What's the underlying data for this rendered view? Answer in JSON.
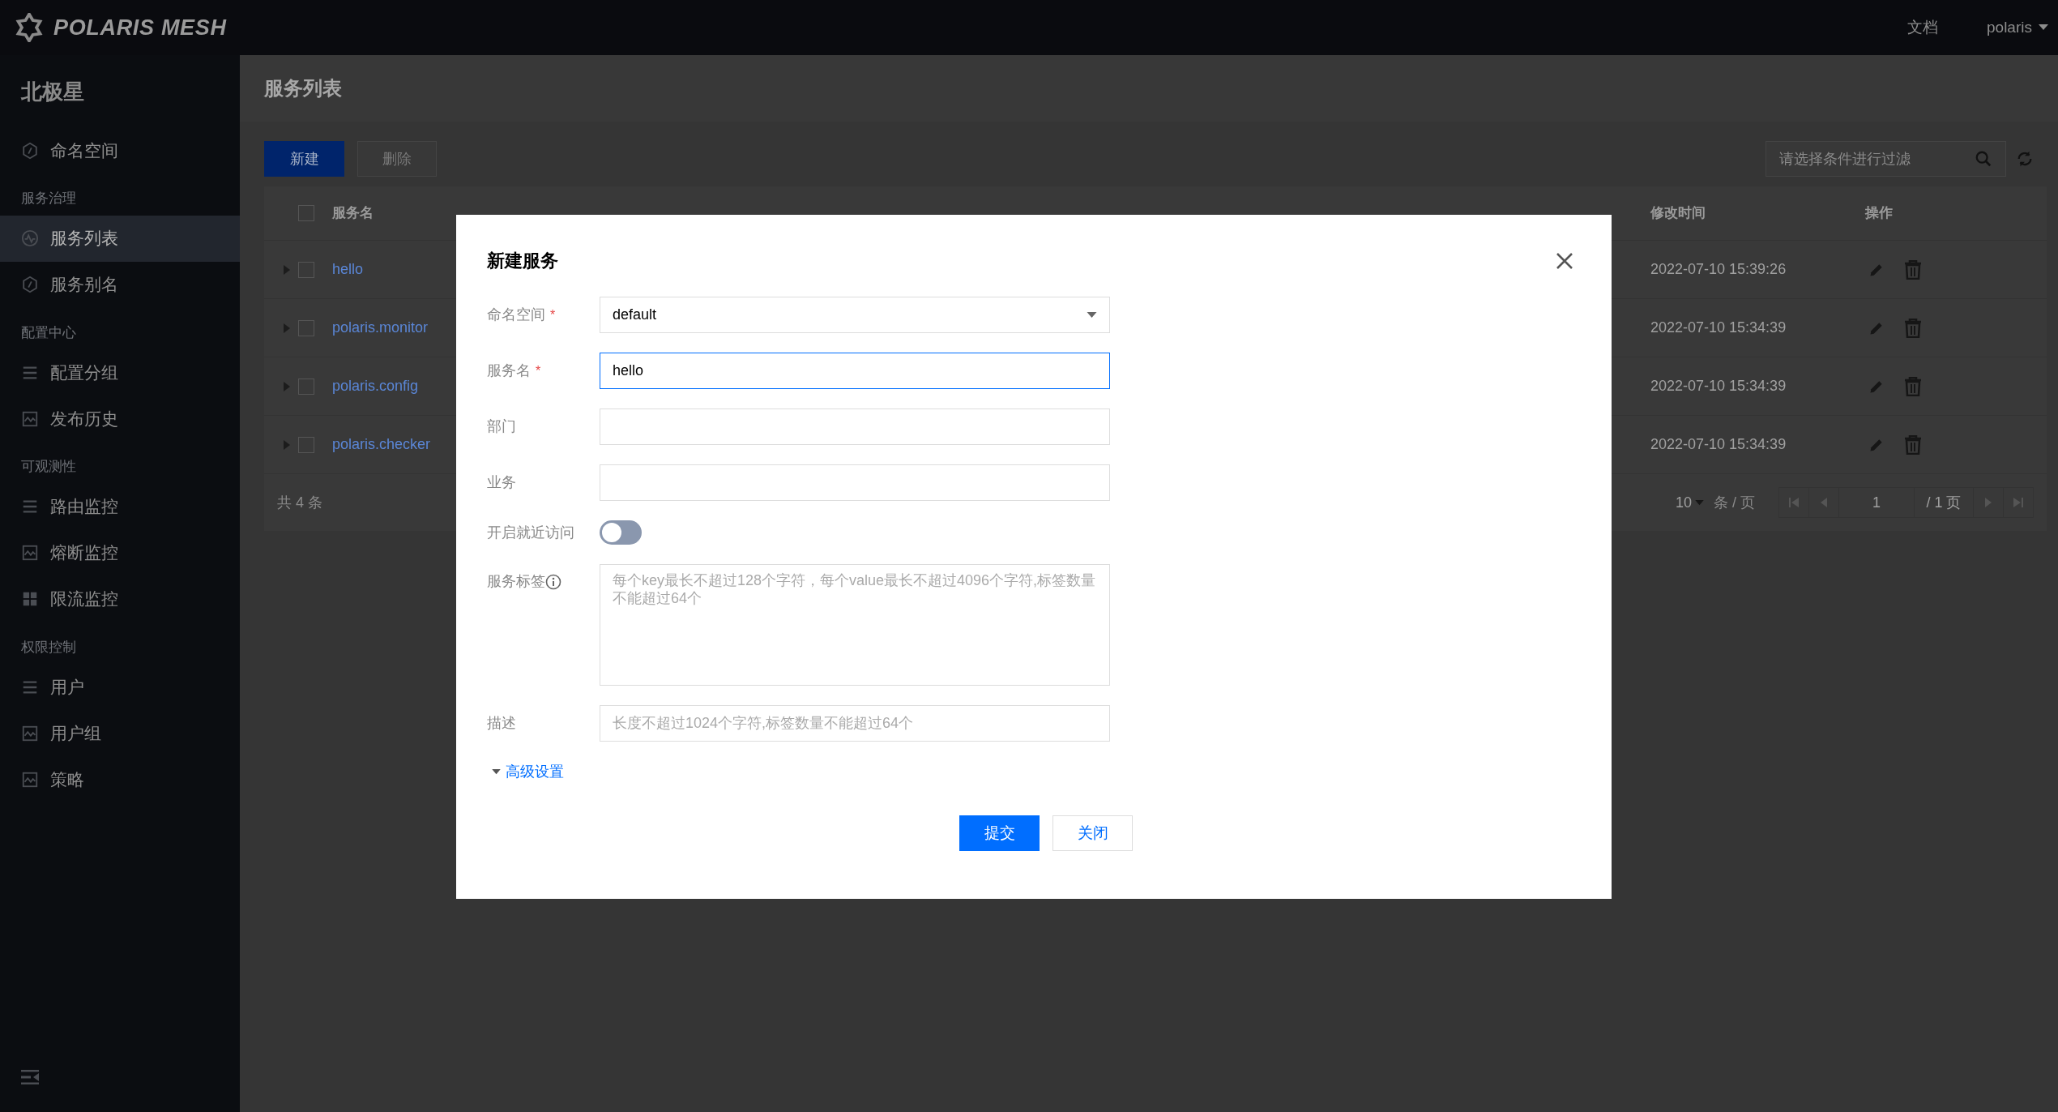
{
  "brand": "POLARIS MESH",
  "topbar": {
    "links": [
      "文档"
    ],
    "user": "polaris"
  },
  "sidebar": {
    "title": "北极星",
    "sections": [
      {
        "items": [
          {
            "label": "命名空间",
            "kind": "hexagon",
            "selected": false
          }
        ]
      },
      {
        "heading": "服务治理",
        "items": [
          {
            "label": "服务列表",
            "kind": "pulse",
            "selected": true
          },
          {
            "label": "服务别名",
            "kind": "hexagon",
            "selected": false
          }
        ]
      },
      {
        "heading": "配置中心",
        "items": [
          {
            "label": "配置分组",
            "kind": "list",
            "selected": false
          },
          {
            "label": "发布历史",
            "kind": "chart",
            "selected": false
          }
        ]
      },
      {
        "heading": "可观测性",
        "items": [
          {
            "label": "路由监控",
            "kind": "list",
            "selected": false
          },
          {
            "label": "熔断监控",
            "kind": "chart",
            "selected": false
          },
          {
            "label": "限流监控",
            "kind": "grid",
            "selected": false
          }
        ]
      },
      {
        "heading": "权限控制",
        "items": [
          {
            "label": "用户",
            "kind": "list",
            "selected": false
          },
          {
            "label": "用户组",
            "kind": "chart",
            "selected": false
          },
          {
            "label": "策略",
            "kind": "chart",
            "selected": false
          }
        ]
      }
    ]
  },
  "page_title": "服务列表",
  "toolbar": {
    "create": "新建",
    "delete": "删除",
    "search_placeholder": "请选择条件进行过滤"
  },
  "table": {
    "columns": {
      "name": "服务名",
      "modified": "修改时间",
      "actions": "操作"
    },
    "all_checked": false,
    "rows": [
      {
        "name": "hello",
        "modified": "2022-07-10 15:39:26",
        "checked": false
      },
      {
        "name": "polaris.monitor",
        "modified": "2022-07-10 15:34:39",
        "checked": false
      },
      {
        "name": "polaris.config",
        "modified": "2022-07-10 15:34:39",
        "checked": false
      },
      {
        "name": "polaris.checker",
        "modified": "2022-07-10 15:34:39",
        "checked": false
      }
    ],
    "total": "共 4 条",
    "page_size": "10",
    "per_page": "条 / 页",
    "page": "1",
    "pages": "/ 1 页"
  },
  "dialog": {
    "title": "新建服务",
    "fields": [
      {
        "kind": "select",
        "label": "命名空间",
        "required_mark": "*",
        "value": "default"
      },
      {
        "kind": "input",
        "label": "服务名",
        "required_mark": "*",
        "value": "hello",
        "focused": true
      },
      {
        "kind": "input",
        "label": "部门",
        "focused": false
      },
      {
        "kind": "input",
        "label": "业务",
        "focused": false
      },
      {
        "kind": "switch",
        "label": "开启就近访问",
        "on": false
      },
      {
        "kind": "textarea",
        "label": "服务标签",
        "placeholder": "每个key最长不超过128个字符，每个value最长不超过4096个字符,标签数量不能超过64个"
      },
      {
        "kind": "input",
        "label": "描述",
        "focused": false,
        "placeholder": "长度不超过1024个字符,标签数量不能超过64个"
      }
    ],
    "advanced": "高级设置",
    "submit": "提交",
    "close": "关闭"
  }
}
